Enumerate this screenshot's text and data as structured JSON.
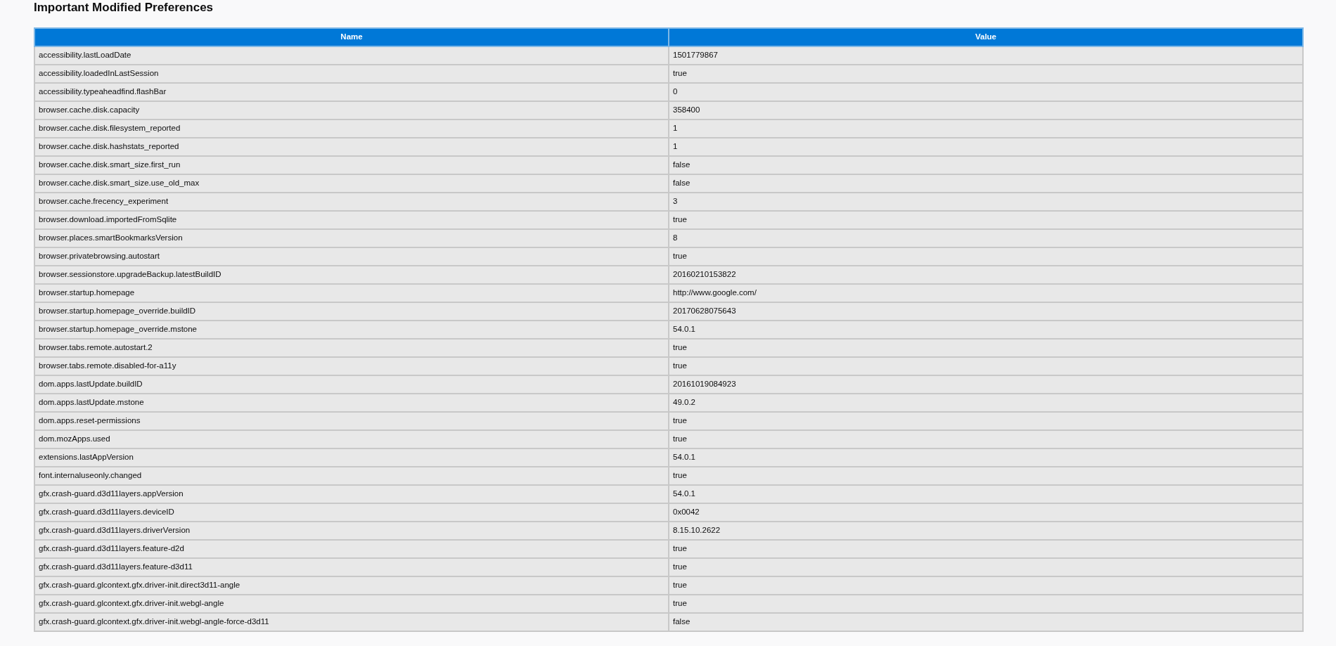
{
  "title": "Important Modified Preferences",
  "table": {
    "columns": [
      "Name",
      "Value"
    ],
    "rows": [
      [
        "accessibility.lastLoadDate",
        "1501779867"
      ],
      [
        "accessibility.loadedInLastSession",
        "true"
      ],
      [
        "accessibility.typeaheadfind.flashBar",
        "0"
      ],
      [
        "browser.cache.disk.capacity",
        "358400"
      ],
      [
        "browser.cache.disk.filesystem_reported",
        "1"
      ],
      [
        "browser.cache.disk.hashstats_reported",
        "1"
      ],
      [
        "browser.cache.disk.smart_size.first_run",
        "false"
      ],
      [
        "browser.cache.disk.smart_size.use_old_max",
        "false"
      ],
      [
        "browser.cache.frecency_experiment",
        "3"
      ],
      [
        "browser.download.importedFromSqlite",
        "true"
      ],
      [
        "browser.places.smartBookmarksVersion",
        "8"
      ],
      [
        "browser.privatebrowsing.autostart",
        "true"
      ],
      [
        "browser.sessionstore.upgradeBackup.latestBuildID",
        "20160210153822"
      ],
      [
        "browser.startup.homepage",
        "http://www.google.com/"
      ],
      [
        "browser.startup.homepage_override.buildID",
        "20170628075643"
      ],
      [
        "browser.startup.homepage_override.mstone",
        "54.0.1"
      ],
      [
        "browser.tabs.remote.autostart.2",
        "true"
      ],
      [
        "browser.tabs.remote.disabled-for-a11y",
        "true"
      ],
      [
        "dom.apps.lastUpdate.buildID",
        "20161019084923"
      ],
      [
        "dom.apps.lastUpdate.mstone",
        "49.0.2"
      ],
      [
        "dom.apps.reset-permissions",
        "true"
      ],
      [
        "dom.mozApps.used",
        "true"
      ],
      [
        "extensions.lastAppVersion",
        "54.0.1"
      ],
      [
        "font.internaluseonly.changed",
        "true"
      ],
      [
        "gfx.crash-guard.d3d11layers.appVersion",
        "54.0.1"
      ],
      [
        "gfx.crash-guard.d3d11layers.deviceID",
        "0x0042"
      ],
      [
        "gfx.crash-guard.d3d11layers.driverVersion",
        "8.15.10.2622"
      ],
      [
        "gfx.crash-guard.d3d11layers.feature-d2d",
        "true"
      ],
      [
        "gfx.crash-guard.d3d11layers.feature-d3d11",
        "true"
      ],
      [
        "gfx.crash-guard.glcontext.gfx.driver-init.direct3d11-angle",
        "true"
      ],
      [
        "gfx.crash-guard.glcontext.gfx.driver-init.webgl-angle",
        "true"
      ],
      [
        "gfx.crash-guard.glcontext.gfx.driver-init.webgl-angle-force-d3d11",
        "false"
      ]
    ]
  }
}
